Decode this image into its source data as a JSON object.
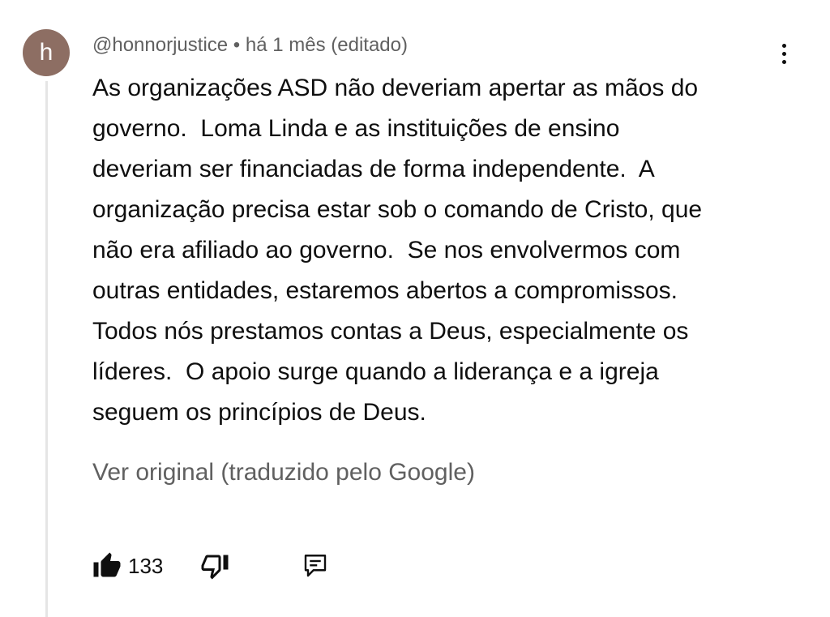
{
  "comment": {
    "avatar_letter": "h",
    "author": "@honnorjustice",
    "separator": "•",
    "time": "há 1 mês (editado)",
    "text_lines": [
      "As organizações ASD não deveriam apertar as mãos do",
      "governo.  Loma Linda e as instituições de ensino",
      "deveriam ser financiadas de forma independente.  A",
      "organização precisa estar sob o comando de Cristo, que",
      "não era afiliado ao governo.  Se nos envolvermos com",
      "outras entidades, estaremos abertos a compromissos.",
      "Todos nós prestamos contas a Deus, especialmente os",
      "líderes.  O apoio surge quando a liderança e a igreja",
      "seguem os princípios de Deus."
    ],
    "translate_label": "Ver original (traduzido pelo Google)",
    "like_count": "133"
  },
  "icons": {
    "more": "more-vert-icon",
    "like": "thumbs-up-filled-icon",
    "dislike": "thumbs-down-outline-icon",
    "reply": "comment-icon"
  },
  "colors": {
    "avatar_bg": "#8d6e63",
    "primary_text": "#0f0f0f",
    "secondary_text": "#606060",
    "thread_line": "#e5e5e5"
  }
}
